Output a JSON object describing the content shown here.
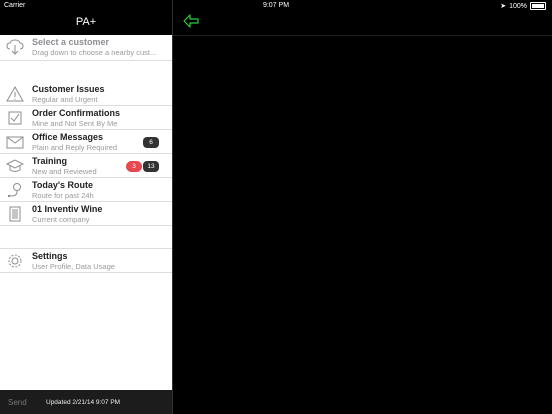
{
  "status_bar": {
    "carrier": "Carrier",
    "time": "9:07 PM",
    "battery": "100%"
  },
  "sidebar": {
    "title": "PA+",
    "customer": {
      "title": "Select a customer",
      "subtitle": "Drag down to choose a nearby cust..."
    },
    "items": [
      {
        "title": "Customer Issues",
        "subtitle": "Regular and Urgent",
        "icon": "warning-icon"
      },
      {
        "title": "Order Confirmations",
        "subtitle": "Mine and Not Sent By Me",
        "icon": "checkbox-icon"
      },
      {
        "title": "Office Messages",
        "subtitle": "Plain and Reply Required",
        "icon": "envelope-icon",
        "badge": "6"
      },
      {
        "title": "Training",
        "subtitle": "New and Reviewed",
        "icon": "graduation-cap-icon",
        "badge_red": "3",
        "badge": "13"
      },
      {
        "title": "Today's Route",
        "subtitle": "Route for past 24h",
        "icon": "route-icon"
      },
      {
        "title": "01 Inventiv Wine",
        "subtitle": "Current company",
        "icon": "building-icon"
      }
    ],
    "settings": {
      "title": "Settings",
      "subtitle": "User Profile, Data Usage",
      "icon": "gear-icon"
    },
    "footer": {
      "send": "Send",
      "updated": "Updated   2/21/14   9:07 PM"
    }
  },
  "main": {
    "back_icon": "back-arrow-icon",
    "accent_color": "#2ecc40"
  }
}
